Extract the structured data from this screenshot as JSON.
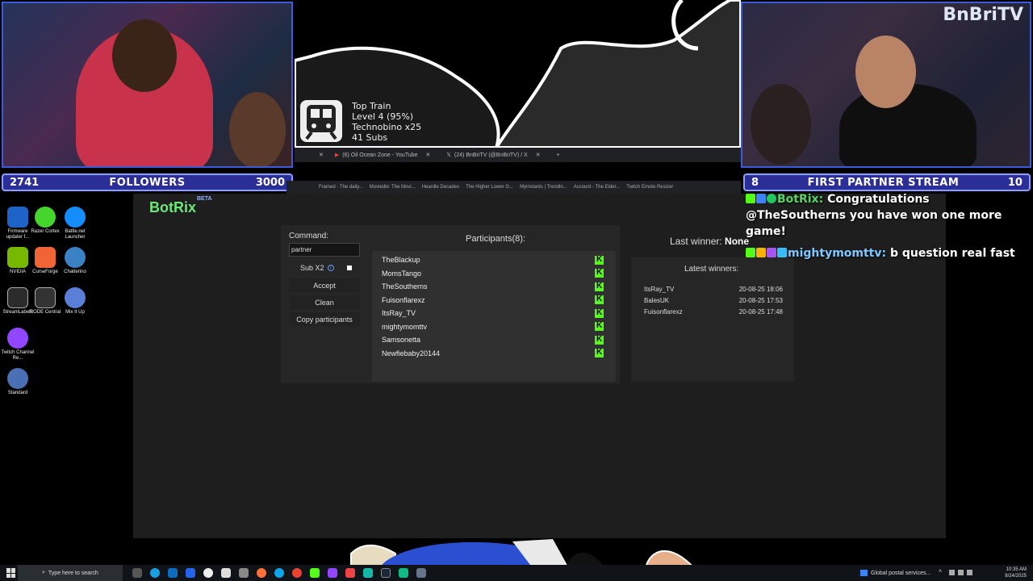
{
  "overlay": {
    "brand": "BnBriTV",
    "followers": {
      "count": "2741",
      "label": "FOLLOWERS",
      "goal": "3000"
    },
    "partner_bar": {
      "count": "8",
      "label": "FIRST PARTNER STREAM",
      "goal": "10"
    },
    "train": {
      "line1": "Top Train",
      "line2": "Level 4 (95%)",
      "line3": "Technobino x25",
      "line4": "41 Subs"
    }
  },
  "browser": {
    "tabs": [
      "(6) Oil Ocean Zone - YouTube",
      "(24) BnBriTV (@BnBriTV) / X"
    ],
    "bookmarks": [
      "Framed - The daily...",
      "Moviedle: The Movi...",
      "Heardle Decades",
      "The Higher Lower G...",
      "Myinstants | Trendin...",
      "Account - The Elder...",
      "Twitch Emote Resizer"
    ]
  },
  "desktop": {
    "icons": [
      {
        "label": "Firmware updater f...",
        "color": "#1e64c8"
      },
      {
        "label": "Razer Cortex",
        "color": "#44d62c"
      },
      {
        "label": "Battle.net Launcher",
        "color": "#148eff"
      },
      {
        "label": "NVIDIA",
        "color": "#76b900"
      },
      {
        "label": "CurseForge",
        "color": "#f16436"
      },
      {
        "label": "Chatterino",
        "color": "#3b82c4"
      },
      {
        "label": "StreamLabels",
        "color": "#2b2b2b"
      },
      {
        "label": "RODE Central",
        "color": "#333333"
      },
      {
        "label": "Mix It Up",
        "color": "#5a7fd6"
      },
      {
        "label": "Twitch Channel Re...",
        "color": "#9146ff"
      },
      {
        "label": "Standard",
        "color": "#4a6fb5"
      }
    ]
  },
  "app": {
    "logo": "BotRix",
    "beta": "BETA",
    "command_label": "Command:",
    "command_value": "partner",
    "sub_label": "Sub X2",
    "buttons": {
      "accept": "Accept",
      "clean": "Clean",
      "copy": "Copy participants"
    },
    "participants_title": "Participants(8):",
    "participants": [
      "TheBlackup",
      "MomsTango",
      "TheSoutherns",
      "Fuisonflarexz",
      "ItsRay_TV",
      "mightymomttv",
      "Samsonetta",
      "Newfiebaby20144"
    ],
    "last_winner_label": "Last winner:",
    "last_winner_value": "None",
    "latest_winners_title": "Latest winners:",
    "latest_winners": [
      {
        "name": "ItsRay_TV",
        "time": "20-08-25 18:06"
      },
      {
        "name": "BalesUK",
        "time": "20-08-25 17:53"
      },
      {
        "name": "Fuisonflarexz",
        "time": "20-08-25 17:48"
      }
    ]
  },
  "chat": {
    "msg1_user": "BotRix:",
    "msg1_text": " Congratulations @TheSoutherns you have won one more game!",
    "msg2_user": "mightymomttv:",
    "msg2_text": " b question real fast"
  },
  "taskbar": {
    "search_placeholder": "Type here to search",
    "news": "Global postal services...",
    "time": "10:35 AM",
    "date": "8/24/2025"
  }
}
